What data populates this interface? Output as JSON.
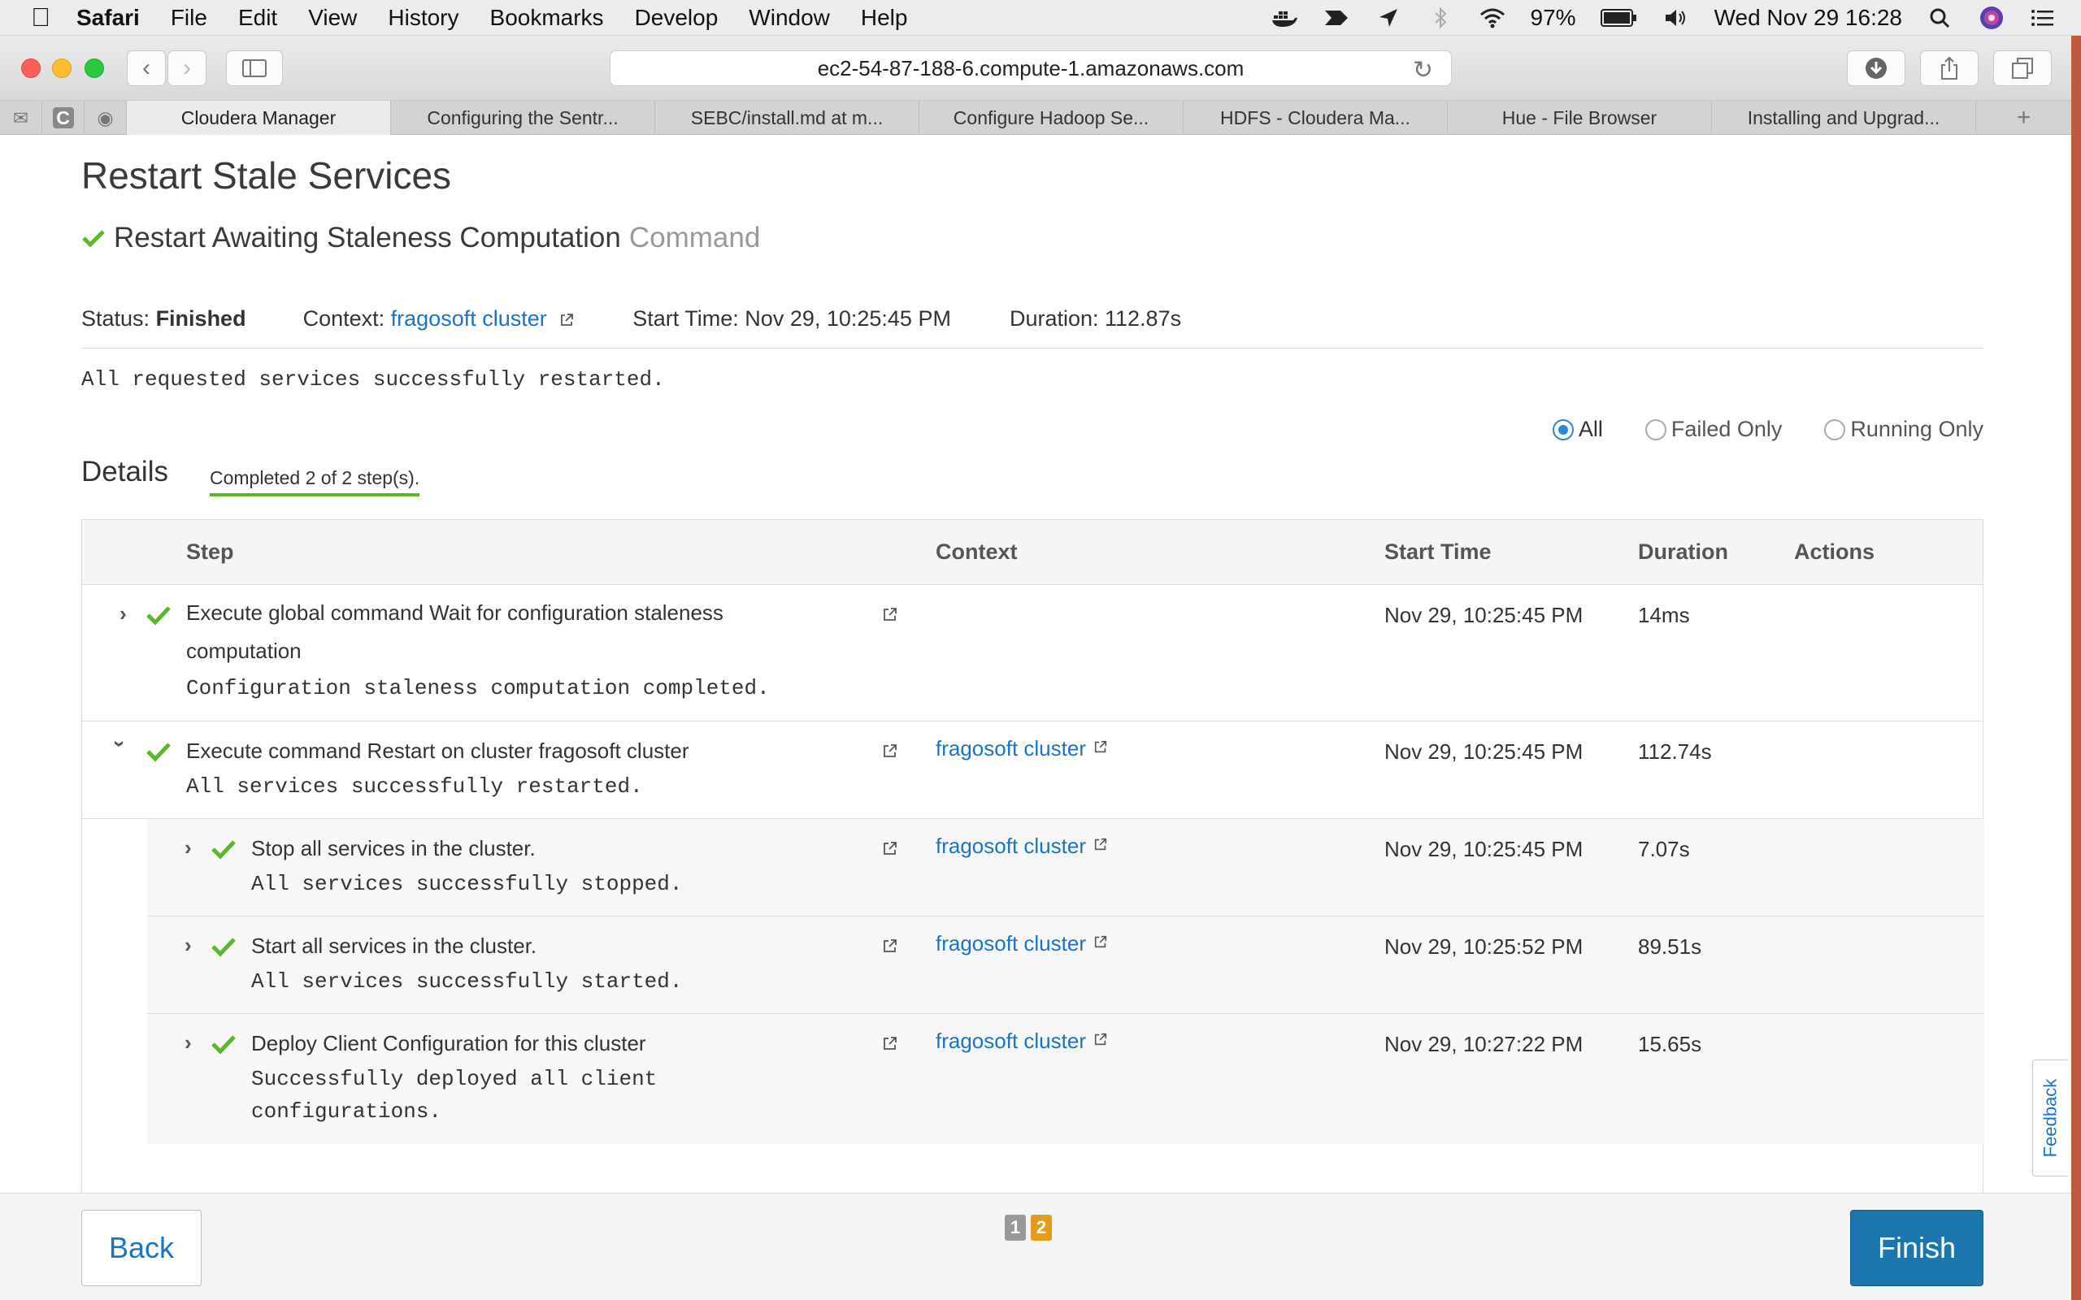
{
  "menubar": {
    "app": "Safari",
    "items": [
      "File",
      "Edit",
      "View",
      "History",
      "Bookmarks",
      "Develop",
      "Window",
      "Help"
    ],
    "battery": "97%",
    "datetime": "Wed Nov 29  16:28"
  },
  "toolbar": {
    "url": "ec2-54-87-188-6.compute-1.amazonaws.com"
  },
  "tabs": [
    "Cloudera Manager",
    "Configuring the Sentr...",
    "SEBC/install.md at m...",
    "Configure Hadoop Se...",
    "HDFS - Cloudera Ma...",
    "Hue - File Browser",
    "Installing and Upgrad..."
  ],
  "page": {
    "title": "Restart Stale Services",
    "command_name": "Restart Awaiting Staleness Computation",
    "command_suffix": "Command",
    "status_label": "Status:",
    "status_value": "Finished",
    "context_label": "Context:",
    "context_value": "fragosoft cluster",
    "start_time": "Start Time: Nov 29, 10:25:45 PM",
    "duration": "Duration: 112.87s",
    "result_message": "All requested services successfully restarted.",
    "filters": [
      "All",
      "Failed Only",
      "Running Only"
    ],
    "selected_filter": "All",
    "details_title": "Details",
    "progress_text": "Completed 2 of 2 step(s)."
  },
  "table": {
    "headers": {
      "step": "Step",
      "context": "Context",
      "start_time": "Start Time",
      "duration": "Duration",
      "actions": "Actions"
    },
    "rows": [
      {
        "name_line1": "Execute global command Wait for configuration staleness",
        "name_line2": "computation",
        "message": "Configuration staleness computation completed.",
        "context": "",
        "start": "Nov 29, 10:25:45 PM",
        "duration": "14ms",
        "expanded": false
      },
      {
        "name_line1": "Execute command Restart on cluster fragosoft cluster",
        "message": "All services successfully restarted.",
        "context": "fragosoft cluster",
        "start": "Nov 29, 10:25:45 PM",
        "duration": "112.74s",
        "expanded": true
      },
      {
        "name_line1": "Stop all services in the cluster.",
        "message": "All services successfully stopped.",
        "context": "fragosoft cluster",
        "start": "Nov 29, 10:25:45 PM",
        "duration": "7.07s"
      },
      {
        "name_line1": "Start all services in the cluster.",
        "message": "All services successfully started.",
        "context": "fragosoft cluster",
        "start": "Nov 29, 10:25:52 PM",
        "duration": "89.51s"
      },
      {
        "name_line1": "Deploy Client Configuration for this cluster",
        "message_line1": "Successfully deployed all client",
        "message_line2": "configurations.",
        "context": "fragosoft cluster",
        "start": "Nov 29, 10:27:22 PM",
        "duration": "15.65s"
      }
    ]
  },
  "footer": {
    "back_label": "Back",
    "finish_label": "Finish",
    "pages": [
      "1",
      "2"
    ]
  },
  "feedback_label": "Feedback",
  "colors": {
    "link": "#1a74c6",
    "success_check": "#5cb82a",
    "primary_button": "#1b76ae",
    "current_page": "#e89a1a"
  }
}
